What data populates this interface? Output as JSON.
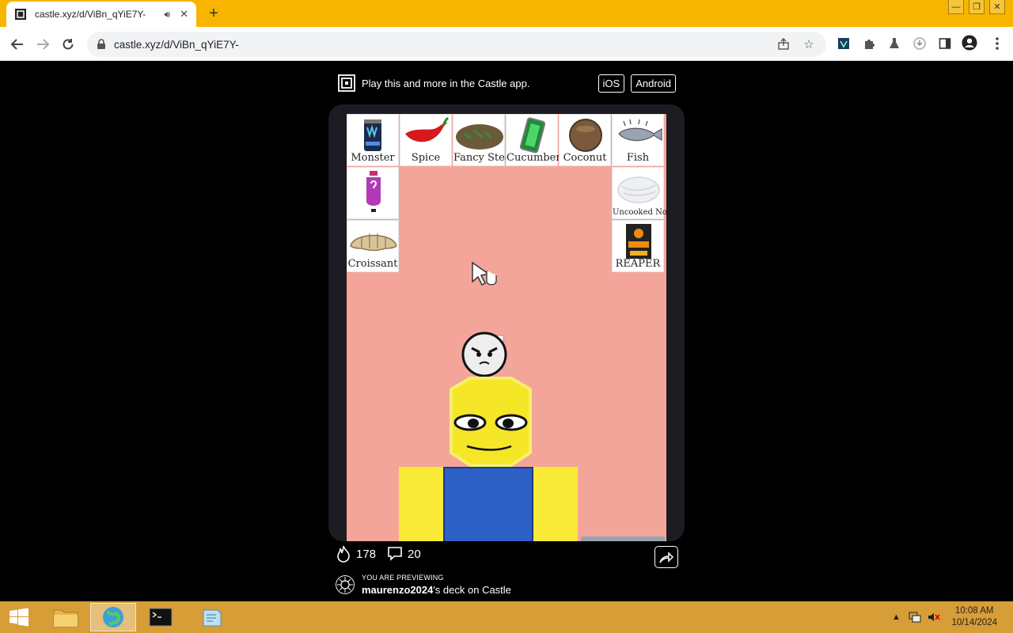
{
  "browser": {
    "tab_title": "castle.xyz/d/ViBn_qYiE7Y-",
    "url": "castle.xyz/d/ViBn_qYiE7Y-",
    "new_tab": "+",
    "window_controls": {
      "minimize": "—",
      "restore": "❐",
      "close": "✕"
    }
  },
  "banner": {
    "text": "Play this and more in the Castle app.",
    "ios": "iOS",
    "android": "Android"
  },
  "game": {
    "items": [
      {
        "label": "Monster"
      },
      {
        "label": "Spice"
      },
      {
        "label": "Fancy Steak"
      },
      {
        "label": "Cucumber"
      },
      {
        "label": "Coconut"
      },
      {
        "label": "Fish"
      },
      {
        "label": ""
      },
      {
        "label": "Uncooked Noodles"
      },
      {
        "label": "Croissant"
      },
      {
        "label": "REAPER"
      }
    ]
  },
  "stats": {
    "likes": "178",
    "comments": "20"
  },
  "preview": {
    "label": "YOU ARE PREVIEWING",
    "author": "maurenzo2024",
    "suffix": "'s deck on Castle"
  },
  "taskbar": {
    "time": "10:08 AM",
    "date": "10/14/2024"
  },
  "colors": {
    "chrome_accent": "#f7b500",
    "game_bg": "#f4a59a",
    "taskbar": "#d79d36"
  }
}
